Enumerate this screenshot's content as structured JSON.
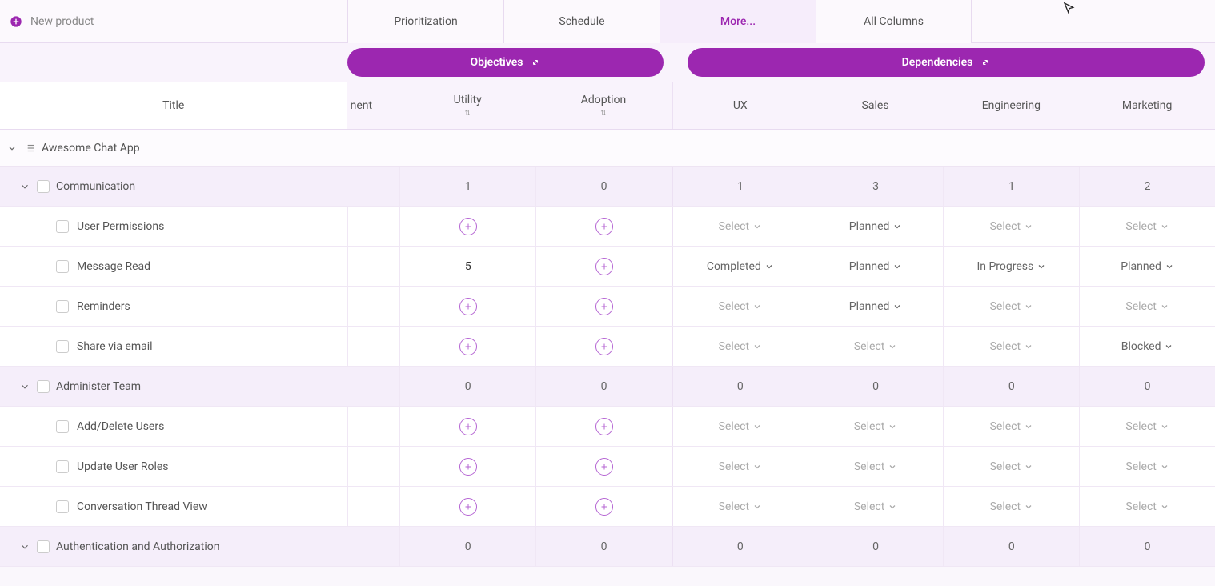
{
  "header": {
    "new_product": "New product",
    "tabs": [
      "Prioritization",
      "Schedule",
      "More...",
      "All Columns"
    ],
    "active_tab_index": 2
  },
  "column_groups": {
    "objectives": "Objectives",
    "dependencies": "Dependencies"
  },
  "columns": {
    "title": "Title",
    "partial": "nent",
    "utility": "Utility",
    "adoption": "Adoption",
    "ux": "UX",
    "sales": "Sales",
    "engineering": "Engineering",
    "marketing": "Marketing"
  },
  "product": "Awesome Chat App",
  "groups": [
    {
      "name": "Communication",
      "summary": {
        "utility": "1",
        "adoption": "0",
        "ux": "1",
        "sales": "3",
        "engineering": "1",
        "marketing": "2"
      },
      "items": [
        {
          "name": "User Permissions",
          "utility": "",
          "adoption": "",
          "ux": "Select",
          "sales": "Planned",
          "engineering": "Select",
          "marketing": "Select"
        },
        {
          "name": "Message Read",
          "utility": "5",
          "adoption": "",
          "ux": "Completed",
          "sales": "Planned",
          "engineering": "In Progress",
          "marketing": "Planned"
        },
        {
          "name": "Reminders",
          "utility": "",
          "adoption": "",
          "ux": "Select",
          "sales": "Planned",
          "engineering": "Select",
          "marketing": "Select"
        },
        {
          "name": "Share via email",
          "utility": "",
          "adoption": "",
          "ux": "Select",
          "sales": "Select",
          "engineering": "Select",
          "marketing": "Blocked"
        }
      ]
    },
    {
      "name": "Administer Team",
      "summary": {
        "utility": "0",
        "adoption": "0",
        "ux": "0",
        "sales": "0",
        "engineering": "0",
        "marketing": "0"
      },
      "items": [
        {
          "name": "Add/Delete Users",
          "utility": "",
          "adoption": "",
          "ux": "Select",
          "sales": "Select",
          "engineering": "Select",
          "marketing": "Select"
        },
        {
          "name": "Update User Roles",
          "utility": "",
          "adoption": "",
          "ux": "Select",
          "sales": "Select",
          "engineering": "Select",
          "marketing": "Select"
        },
        {
          "name": "Conversation Thread View",
          "utility": "",
          "adoption": "",
          "ux": "Select",
          "sales": "Select",
          "engineering": "Select",
          "marketing": "Select"
        }
      ]
    },
    {
      "name": "Authentication and Authorization",
      "summary": {
        "utility": "0",
        "adoption": "0",
        "ux": "0",
        "sales": "0",
        "engineering": "0",
        "marketing": "0"
      },
      "items": []
    }
  ],
  "select_label": "Select"
}
